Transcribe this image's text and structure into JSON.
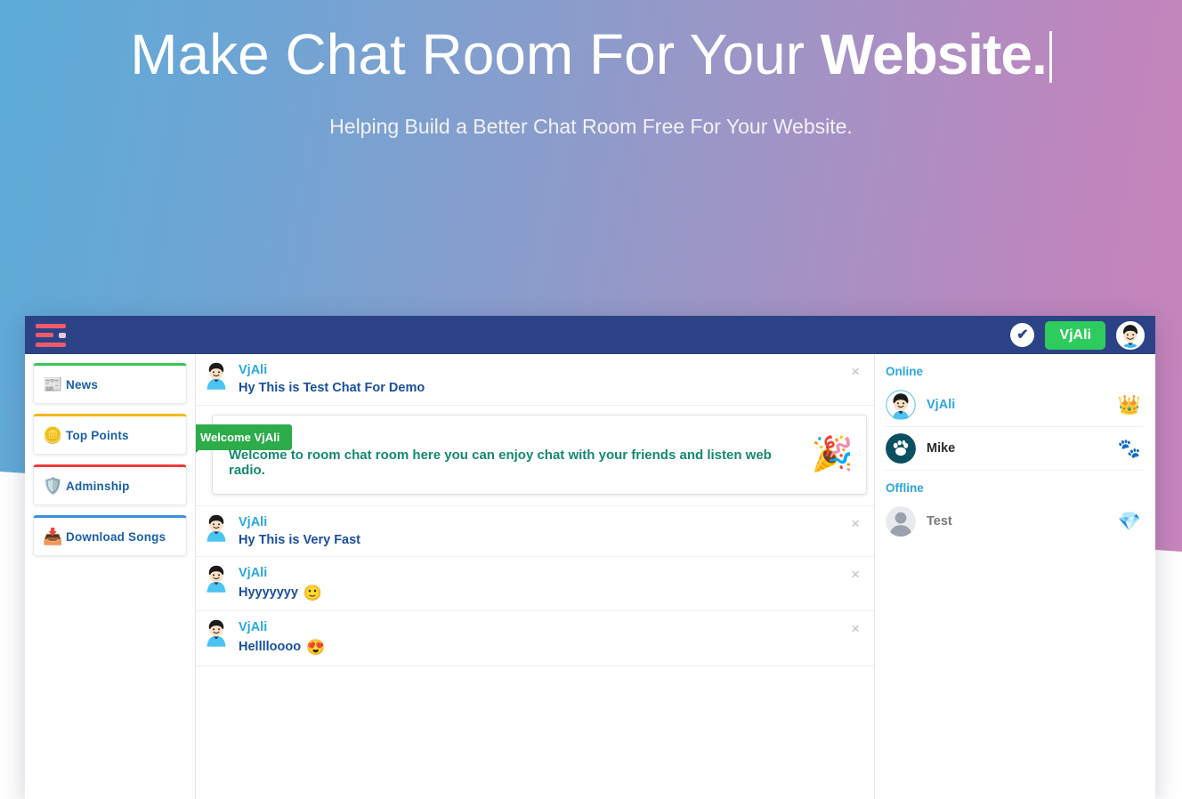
{
  "hero": {
    "title_light": "Make Chat Room For Your ",
    "title_bold": "Website.",
    "subtitle": "Helping Build a Better Chat Room Free For Your Website."
  },
  "topbar": {
    "menu_icon": "hamburger-icon",
    "verified_icon": "check-circle-icon",
    "verified_glyph": "✔",
    "user_button": "VjAli",
    "avatar_icon": "user-avatar"
  },
  "sidebar": {
    "items": [
      {
        "label": "News",
        "icon": "newspaper-icon",
        "glyph": "📰",
        "accent": "#34c759"
      },
      {
        "label": "Top Points",
        "icon": "coins-icon",
        "glyph": "🪙",
        "accent": "#f5b820"
      },
      {
        "label": "Adminship",
        "icon": "shield-check-icon",
        "glyph": "🛡️",
        "accent": "#ef3b3b"
      },
      {
        "label": "Download Songs",
        "icon": "download-icon",
        "glyph": "📥",
        "accent": "#3b90e0"
      }
    ]
  },
  "chat": {
    "close_glyph": "×",
    "messages": [
      {
        "user": "VjAli",
        "text": "Hy This is Test Chat For Demo",
        "emoji": ""
      },
      {
        "user": "VjAli",
        "text": "Hy This is Very Fast",
        "emoji": ""
      },
      {
        "user": "VjAli",
        "text": "Hyyyyyyy",
        "emoji": "🙂"
      },
      {
        "user": "VjAli",
        "text": "Helllloooo",
        "emoji": "😍"
      }
    ],
    "welcome": {
      "ribbon": "Welcome VjAli",
      "body": "Welcome to room chat room here you can enjoy chat with your friends and listen web radio.",
      "decor_icon": "party-popper-icon",
      "decor_glyph": "🎉"
    }
  },
  "users": {
    "online_title": "Online",
    "offline_title": "Offline",
    "online": [
      {
        "name": "VjAli",
        "badge": "👑",
        "badge_icon": "crown-icon",
        "avatar": "boy-avatar"
      },
      {
        "name": "Mike",
        "badge": "🐾",
        "badge_icon": "paw-icon",
        "avatar": "paw-avatar"
      }
    ],
    "offline": [
      {
        "name": "Test",
        "badge": "💎",
        "badge_icon": "diamond-icon",
        "avatar": "default-avatar"
      }
    ]
  },
  "colors": {
    "topbar": "#2b4386",
    "accent_green": "#2ecc5e",
    "link_blue": "#2aa7e0",
    "msg_blue": "#1a4f9c",
    "welcome_green": "#15896f"
  }
}
